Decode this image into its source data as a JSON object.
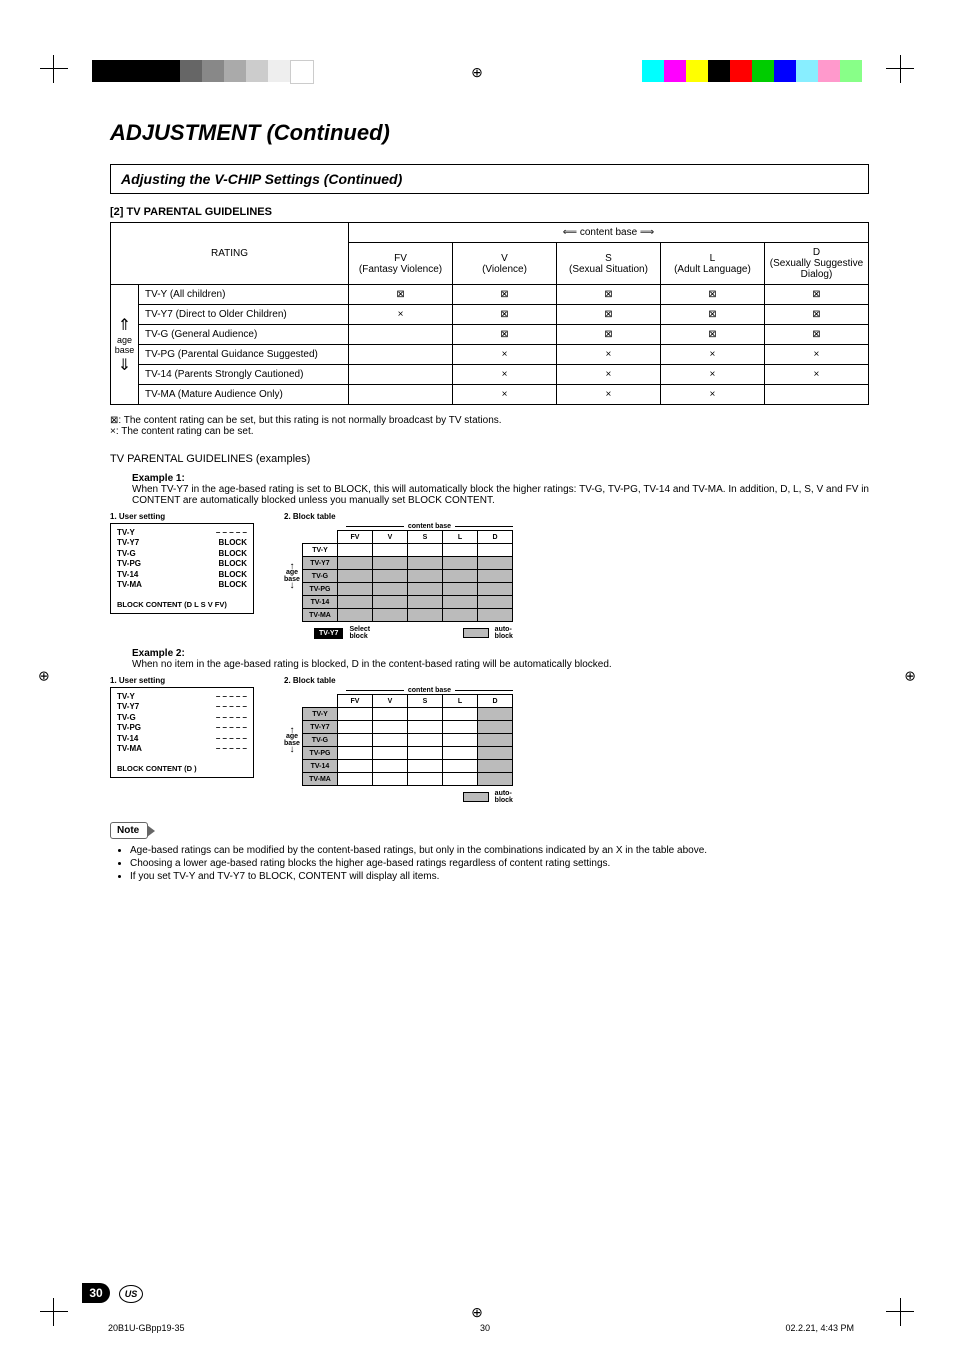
{
  "page": {
    "number": "30",
    "region": "US",
    "footer_file": "20B1U-GBpp19-35",
    "footer_page": "30",
    "footer_ts": "02.2.21, 4:43 PM"
  },
  "headings": {
    "main": "ADJUSTMENT (Continued)",
    "sub": "Adjusting the V-CHIP Settings (Continued)",
    "section": "[2] TV PARENTAL GUIDELINES",
    "examples_title": "TV PARENTAL GUIDELINES (examples)"
  },
  "table": {
    "rating_head": "RATING",
    "content_base": "content base",
    "age_base": "age\nbase",
    "cols": [
      {
        "code": "FV",
        "label": "(Fantasy Violence)"
      },
      {
        "code": "V",
        "label": "(Violence)"
      },
      {
        "code": "S",
        "label": "(Sexual Situation)"
      },
      {
        "code": "L",
        "label": "(Adult Language)"
      },
      {
        "code": "D",
        "label": "(Sexually Suggestive Dialog)"
      }
    ],
    "rows": [
      {
        "label": "TV-Y (All children)",
        "cells": [
          "⊠",
          "⊠",
          "⊠",
          "⊠",
          "⊠"
        ]
      },
      {
        "label": "TV-Y7 (Direct to Older Children)",
        "cells": [
          "×",
          "⊠",
          "⊠",
          "⊠",
          "⊠"
        ]
      },
      {
        "label": "TV-G (General Audience)",
        "cells": [
          "",
          "⊠",
          "⊠",
          "⊠",
          "⊠"
        ]
      },
      {
        "label": "TV-PG (Parental Guidance Suggested)",
        "cells": [
          "",
          "×",
          "×",
          "×",
          "×"
        ]
      },
      {
        "label": "TV-14 (Parents Strongly Cautioned)",
        "cells": [
          "",
          "×",
          "×",
          "×",
          "×"
        ]
      },
      {
        "label": "TV-MA (Mature Audience Only)",
        "cells": [
          "",
          "×",
          "×",
          "×",
          ""
        ]
      }
    ]
  },
  "legend": {
    "box": "⊠: The content rating can be set, but this rating is not normally broadcast by TV stations.",
    "x": "×: The content rating can be set."
  },
  "examples": {
    "ex1_label": "Example 1:",
    "ex1_body": "When TV-Y7 in the age-based rating is set to BLOCK, this will automatically block the higher ratings: TV-G, TV-PG, TV-14 and TV-MA. In addition, D, L, S, V and FV in CONTENT are automatically blocked unless you manually set BLOCK CONTENT.",
    "ex2_label": "Example 2:",
    "ex2_body": "When no item in the age-based rating is blocked, D in the content-based rating will be automatically blocked."
  },
  "diagram_labels": {
    "user_setting": "1. User setting",
    "block_table": "2. Block table",
    "content_base": "content base",
    "age_base": "age\nbase",
    "cols": [
      "FV",
      "V",
      "S",
      "L",
      "D"
    ],
    "ratings": [
      "TV-Y",
      "TV-Y7",
      "TV-G",
      "TV-PG",
      "TV-14",
      "TV-MA"
    ],
    "select_block": "Select block",
    "auto_block": "auto-\nblock",
    "ex1_footer": "BLOCK CONTENT (D L S V FV)",
    "ex2_footer": "BLOCK CONTENT (D            )"
  },
  "diagram": {
    "ex1_user": [
      {
        "r": "TV-Y",
        "s": "– – – – –"
      },
      {
        "r": "TV-Y7",
        "s": "BLOCK"
      },
      {
        "r": "TV-G",
        "s": "BLOCK"
      },
      {
        "r": "TV-PG",
        "s": "BLOCK"
      },
      {
        "r": "TV-14",
        "s": "BLOCK"
      },
      {
        "r": "TV-MA",
        "s": "BLOCK"
      }
    ],
    "ex2_user": [
      {
        "r": "TV-Y",
        "s": "– – – – –"
      },
      {
        "r": "TV-Y7",
        "s": "– – – – –"
      },
      {
        "r": "TV-G",
        "s": "– – – – –"
      },
      {
        "r": "TV-PG",
        "s": "– – – – –"
      },
      {
        "r": "TV-14",
        "s": "– – – – –"
      },
      {
        "r": "TV-MA",
        "s": "– – – – –"
      }
    ],
    "ex1_selected": "TV-Y7"
  },
  "notes": {
    "label": "Note",
    "items": [
      "Age-based ratings can be modified by the content-based ratings, but only in the combinations indicated by an X in the table above.",
      "Choosing a lower age-based rating blocks the higher age-based ratings regardless of content rating settings.",
      "If you set TV-Y and TV-Y7 to BLOCK, CONTENT will display all items."
    ]
  },
  "chart_data": [
    {
      "type": "table",
      "title": "TV Parental Guidelines — content-base × age-base matrix",
      "columns": [
        "FV",
        "V",
        "S",
        "L",
        "D"
      ],
      "rows": [
        "TV-Y",
        "TV-Y7",
        "TV-G",
        "TV-PG",
        "TV-14",
        "TV-MA"
      ],
      "values": [
        [
          "not-broadcast",
          "not-broadcast",
          "not-broadcast",
          "not-broadcast",
          "not-broadcast"
        ],
        [
          "settable",
          "not-broadcast",
          "not-broadcast",
          "not-broadcast",
          "not-broadcast"
        ],
        [
          "",
          "not-broadcast",
          "not-broadcast",
          "not-broadcast",
          "not-broadcast"
        ],
        [
          "",
          "settable",
          "settable",
          "settable",
          "settable"
        ],
        [
          "",
          "settable",
          "settable",
          "settable",
          "settable"
        ],
        [
          "",
          "settable",
          "settable",
          "settable",
          ""
        ]
      ],
      "legend": {
        "not-broadcast": "⊠ can be set but not normally broadcast",
        "settable": "× can be set",
        "": "not applicable"
      }
    },
    {
      "type": "heatmap",
      "title": "Example 1 block table (select TV-Y7)",
      "columns": [
        "FV",
        "V",
        "S",
        "L",
        "D"
      ],
      "rows": [
        "TV-Y",
        "TV-Y7",
        "TV-G",
        "TV-PG",
        "TV-14",
        "TV-MA"
      ],
      "values": [
        [
          0,
          0,
          0,
          0,
          0
        ],
        [
          1,
          1,
          1,
          1,
          1
        ],
        [
          1,
          1,
          1,
          1,
          1
        ],
        [
          1,
          1,
          1,
          1,
          1
        ],
        [
          1,
          1,
          1,
          1,
          1
        ],
        [
          1,
          1,
          1,
          1,
          1
        ]
      ],
      "legend": {
        "0": "unblocked",
        "1": "auto-blocked"
      }
    },
    {
      "type": "heatmap",
      "title": "Example 2 block table (no age block, D auto-blocked)",
      "columns": [
        "FV",
        "V",
        "S",
        "L",
        "D"
      ],
      "rows": [
        "TV-Y",
        "TV-Y7",
        "TV-G",
        "TV-PG",
        "TV-14",
        "TV-MA"
      ],
      "values": [
        [
          0,
          0,
          0,
          0,
          1
        ],
        [
          0,
          0,
          0,
          0,
          1
        ],
        [
          0,
          0,
          0,
          0,
          1
        ],
        [
          0,
          0,
          0,
          0,
          1
        ],
        [
          0,
          0,
          0,
          0,
          1
        ],
        [
          0,
          0,
          0,
          0,
          1
        ]
      ],
      "legend": {
        "0": "unblocked",
        "1": "auto-blocked"
      }
    }
  ]
}
